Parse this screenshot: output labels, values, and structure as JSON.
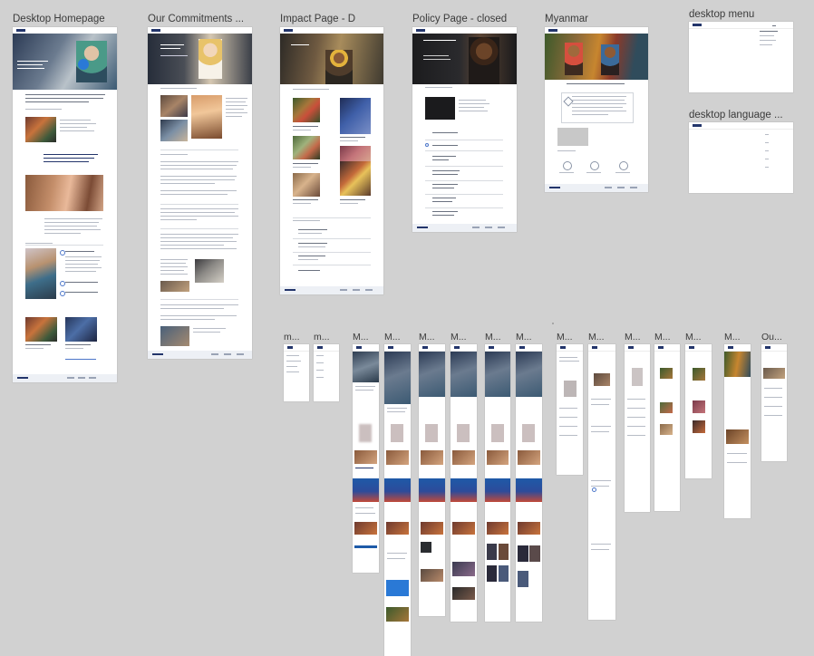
{
  "canvas": {
    "background": "#d1d1d1",
    "frames": [
      {
        "id": "desktop-homepage",
        "label": "Desktop Homepage"
      },
      {
        "id": "our-commitments",
        "label": "Our Commitments ..."
      },
      {
        "id": "impact-page-d",
        "label": "Impact Page - D"
      },
      {
        "id": "policy-page-closed",
        "label": "Policy Page - closed"
      },
      {
        "id": "myanmar",
        "label": "Myanmar"
      },
      {
        "id": "desktop-menu",
        "label": "desktop menu"
      },
      {
        "id": "desktop-language",
        "label": "desktop language ..."
      }
    ],
    "mobile_labels": [
      "m...",
      "m...",
      "M...",
      "M...",
      "M...",
      "M...",
      "M...",
      "M...",
      "M...",
      "M...",
      "M...",
      "M...",
      "M...",
      "Ou..."
    ]
  },
  "colors": {
    "brand_navy": "#23356b",
    "accent_blue": "#1e5aa8",
    "canvas": "#d1d1d1"
  }
}
